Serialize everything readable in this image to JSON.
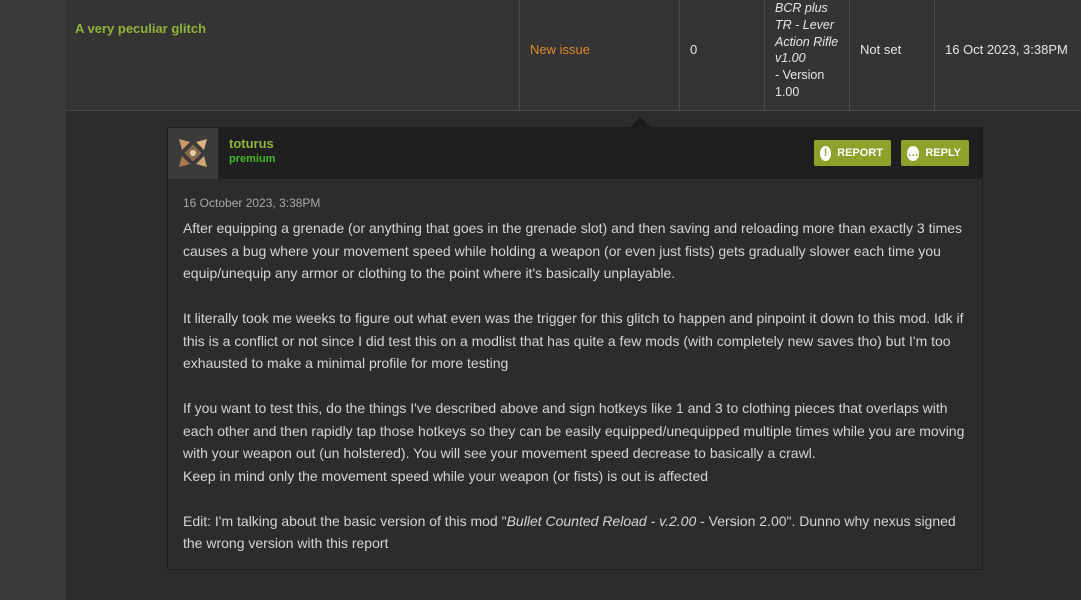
{
  "issue": {
    "title": "A very peculiar glitch",
    "status": "New issue",
    "replies": "0",
    "version_name": "BCR plus TR - Lever Action Rifle v1.00",
    "version_suffix": "- Version 1.00",
    "priority": "Not set",
    "last_post": "16 Oct 2023, 3:38PM"
  },
  "comment": {
    "username": "toturus",
    "role": "premium",
    "report_label": "REPORT",
    "reply_label": "REPLY",
    "date": "16 October 2023, 3:38PM",
    "paragraph1": "After equipping a grenade (or anything that goes in the grenade slot) and then saving and reloading more than exactly 3 times causes a bug where your movement speed while holding a weapon (or even just fists) gets gradually slower each time you equip/unequip any armor or clothing to the point where it's basically unplayable.",
    "paragraph2": "It literally took me weeks to figure out what even was the trigger for this glitch to happen and pinpoint it down to this mod. Idk if this is a conflict or not since I did test this on a modlist that has quite a few mods (with completely new saves tho) but I'm too exhausted to make a minimal profile for more testing",
    "paragraph3": "If you want to test this, do the things I've described above and sign hotkeys like 1 and 3 to clothing pieces that overlaps with each other and then rapidly tap those hotkeys so they can be easily equipped/unequipped multiple times while you are moving with your weapon out (un holstered). You will see your movement speed decrease to basically a crawl.",
    "paragraph3b": "Keep in mind only the movement speed while your weapon (or fists) is out is affected",
    "paragraph4_prefix": "Edit: I'm talking about the basic version of this mod \"",
    "paragraph4_em": "Bullet Counted Reload - v.2.00",
    "paragraph4_suffix": " - Version 2.00\". Dunno why nexus signed the wrong version with this report"
  },
  "colors": {
    "title_green": "#8fb43a",
    "status_orange": "#e0892b",
    "button_olive": "#8fa12b",
    "premium_green": "#46b92a"
  },
  "icons": {
    "report": "exclamation-circle-icon",
    "reply": "speech-bubble-icon"
  }
}
